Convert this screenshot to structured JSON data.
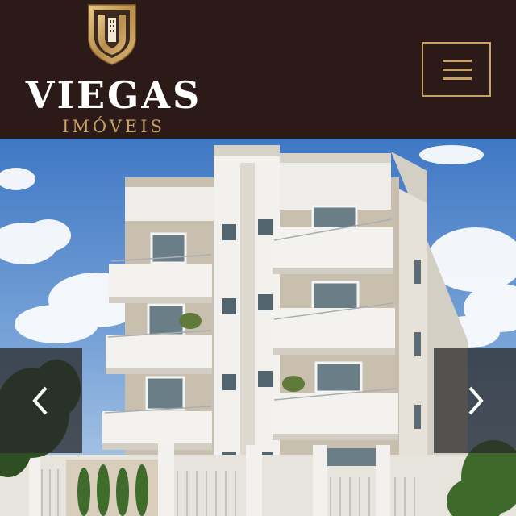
{
  "header": {
    "brand_name": "VIEGAS",
    "brand_sub": "IMÓVEIS",
    "logo_icon": "viegas-shield-logo",
    "menu_icon": "hamburger-menu-icon"
  },
  "carousel": {
    "prev_icon": "chevron-left-icon",
    "next_icon": "chevron-right-icon"
  },
  "colors": {
    "header_bg": "#2b1a17",
    "accent_gold": "#c8a164",
    "brand_white": "#ffffff"
  }
}
